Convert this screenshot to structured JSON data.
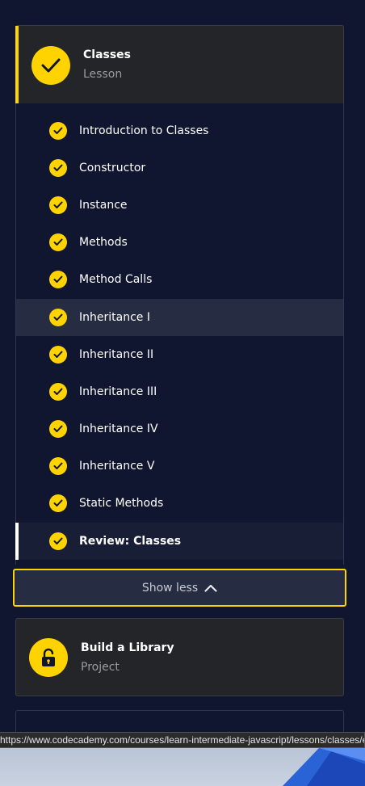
{
  "lesson": {
    "title": "Classes",
    "subtitle": "Lesson",
    "icon": "check-circle-icon"
  },
  "items": [
    {
      "label": "Introduction to Classes",
      "completed": true
    },
    {
      "label": "Constructor",
      "completed": true
    },
    {
      "label": "Instance",
      "completed": true
    },
    {
      "label": "Methods",
      "completed": true
    },
    {
      "label": "Method Calls",
      "completed": true
    },
    {
      "label": "Inheritance I",
      "completed": true
    },
    {
      "label": "Inheritance II",
      "completed": true
    },
    {
      "label": "Inheritance III",
      "completed": true
    },
    {
      "label": "Inheritance IV",
      "completed": true
    },
    {
      "label": "Inheritance V",
      "completed": true
    },
    {
      "label": "Static Methods",
      "completed": true
    },
    {
      "label": "Review: Classes",
      "completed": true
    }
  ],
  "show_less": {
    "label": "Show less",
    "icon": "chevron-up-icon"
  },
  "project": {
    "title": "Build a Library",
    "subtitle": "Project",
    "icon": "lock-icon"
  },
  "status_bar": {
    "url": "https://www.codecademy.com/courses/learn-intermediate-javascript/lessons/classes/e"
  },
  "colors": {
    "background": "#10162f",
    "accent": "#ffd300",
    "card": "#242528",
    "highlight_row": "#262c41"
  }
}
